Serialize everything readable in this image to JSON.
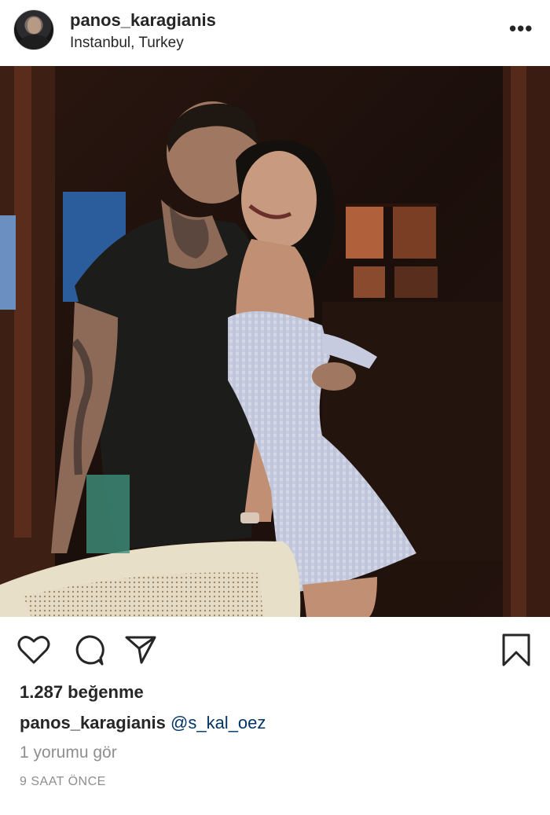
{
  "post": {
    "username": "panos_karagianis",
    "location": "Instanbul, Turkey",
    "more_label": "•••",
    "likes": "1.287 beğenme",
    "caption": {
      "author": "panos_karagianis",
      "mention": "@s_kal_oez"
    },
    "view_comments": "1 yorumu gör",
    "timestamp": "9 SAAT ÖNCE"
  },
  "icons": {
    "like": "heart-icon",
    "comment": "comment-icon",
    "share": "share-icon",
    "save": "bookmark-icon"
  },
  "colors": {
    "text": "#262626",
    "muted": "#8e8e8e",
    "mention": "#003569"
  }
}
